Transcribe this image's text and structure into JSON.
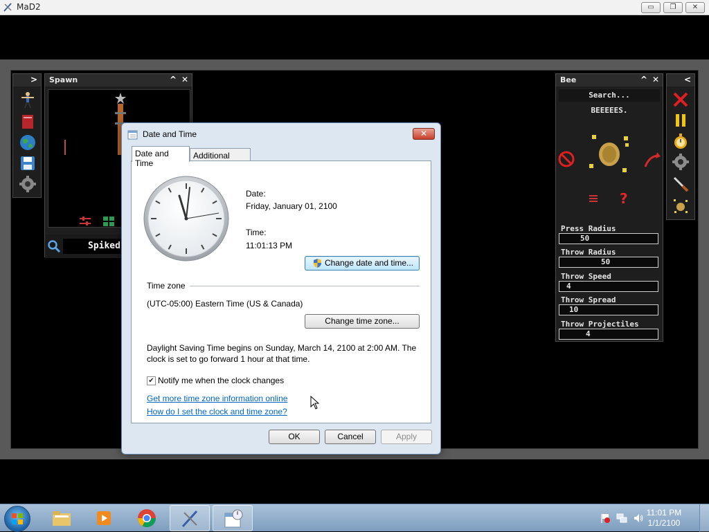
{
  "app": {
    "title": "MaD2"
  },
  "window_controls": {
    "minimize": "▭",
    "restore": "❐",
    "close": "✕"
  },
  "spawn_panel": {
    "title": "Spawn",
    "item_name": "Spiked",
    "collapse": "^",
    "close": "✕",
    "expand": ">"
  },
  "bee_panel": {
    "title": "Bee",
    "search_placeholder": "Search...",
    "description": "BEEEEES.",
    "collapse": "^",
    "close": "✕",
    "properties": [
      {
        "label": "Press Radius",
        "value": "50"
      },
      {
        "label": "Throw Radius",
        "value": "50"
      },
      {
        "label": "Throw Speed",
        "value": "4"
      },
      {
        "label": "Throw Spread",
        "value": "10"
      },
      {
        "label": "Throw Projectiles",
        "value": "4"
      }
    ],
    "help": "?"
  },
  "side_toolbar": {
    "collapse": "<"
  },
  "dialog": {
    "title": "Date and Time",
    "close": "✕",
    "tabs": [
      "Date and Time",
      "Additional Clocks"
    ],
    "date_label": "Date:",
    "date_value": "Friday, January 01, 2100",
    "time_label": "Time:",
    "time_value": "11:01:13 PM",
    "change_datetime_button": "Change date and time...",
    "timezone_heading": "Time zone",
    "timezone_value": "(UTC-05:00) Eastern Time (US & Canada)",
    "change_timezone_button": "Change time zone...",
    "dst_line1": "Daylight Saving Time begins on Sunday, March 14, 2100 at 2:00 AM. The",
    "dst_line2": "clock is set to go forward 1 hour at that time.",
    "notify_label": "Notify me when the clock changes",
    "notify_checked": true,
    "checkmark": "✔",
    "link_more_info": "Get more time zone information online",
    "link_how_to": "How do I set the clock and time zone?",
    "ok": "OK",
    "cancel": "Cancel",
    "apply": "Apply"
  },
  "taskbar": {
    "clock_time": "11:01 PM",
    "clock_date": "1/1/2100"
  }
}
